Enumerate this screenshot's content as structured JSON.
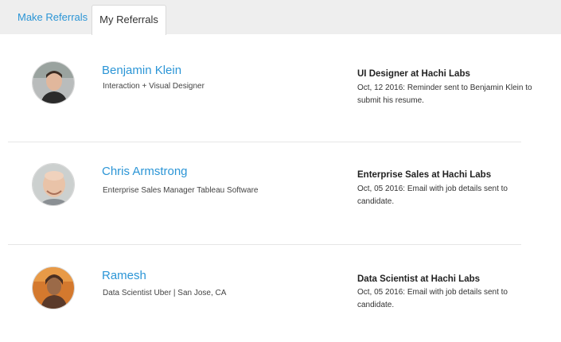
{
  "tabs": {
    "make_referrals": "Make Referrals",
    "my_referrals": "My Referrals",
    "active": "My Referrals"
  },
  "referrals": [
    {
      "name": "Benjamin Klein",
      "title": "Interaction + Visual Designer",
      "job": "UI Designer at Hachi Labs",
      "status": "Oct, 12 2016: Reminder sent to Benjamin Klein to submit his resume.",
      "avatar_icon": "person-photo-icon"
    },
    {
      "name": "Chris Armstrong",
      "title": "Enterprise Sales Manager Tableau Software",
      "job": "Enterprise Sales at Hachi Labs",
      "status": "Oct, 05 2016: Email with job details sent to candidate.",
      "avatar_icon": "person-photo-icon"
    },
    {
      "name": "Ramesh",
      "title": "Data Scientist Uber | San Jose, CA",
      "job": "Data Scientist at Hachi Labs",
      "status": "Oct, 05 2016: Email with job details sent to candidate.",
      "avatar_icon": "person-photo-icon"
    }
  ],
  "colors": {
    "accent": "#2b95d6",
    "tabbar_bg": "#eeeeee",
    "divider": "#e6e6e6"
  }
}
